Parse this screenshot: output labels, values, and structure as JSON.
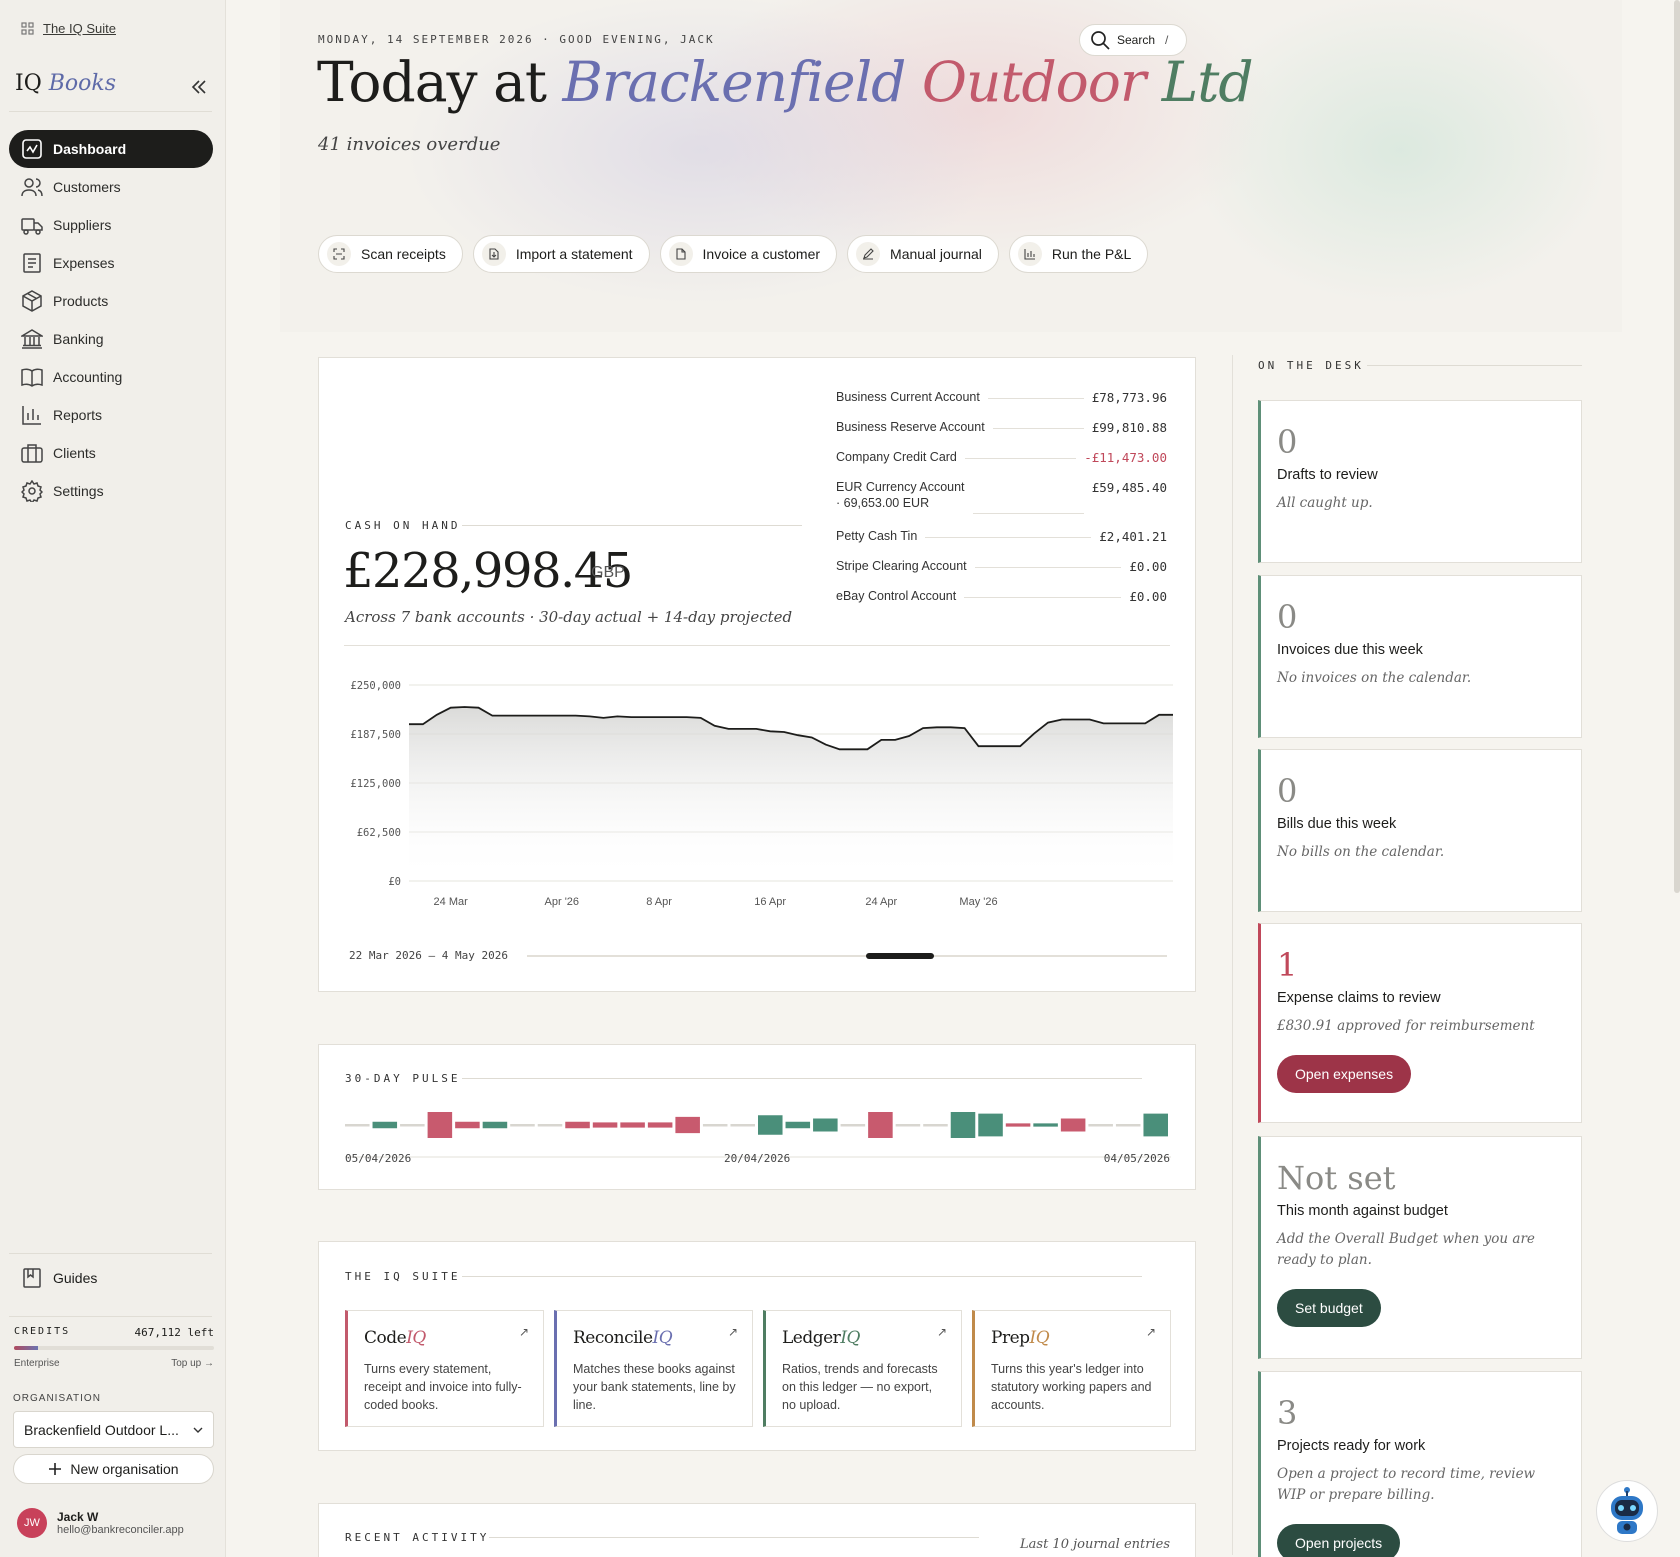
{
  "sidebar": {
    "suite_link": "The IQ Suite",
    "brand_a": "IQ",
    "brand_b": "Books",
    "nav": [
      {
        "label": "Dashboard",
        "icon": "dashboard-icon",
        "active": true
      },
      {
        "label": "Customers",
        "icon": "users-icon"
      },
      {
        "label": "Suppliers",
        "icon": "truck-icon"
      },
      {
        "label": "Expenses",
        "icon": "receipt-icon"
      },
      {
        "label": "Products",
        "icon": "box-icon"
      },
      {
        "label": "Banking",
        "icon": "bank-icon"
      },
      {
        "label": "Accounting",
        "icon": "book-icon"
      },
      {
        "label": "Reports",
        "icon": "bar-chart-icon"
      },
      {
        "label": "Clients",
        "icon": "briefcase-icon"
      },
      {
        "label": "Settings",
        "icon": "gear-icon"
      }
    ],
    "guides": "Guides",
    "credits_label": "CREDITS",
    "credits_value": "467,112 left",
    "credits_fraction": 0.12,
    "plan": "Enterprise",
    "top_up": "Top up →",
    "org_label": "ORGANISATION",
    "org_value": "Brackenfield Outdoor L...",
    "new_org": "New organisation",
    "user_initials": "JW",
    "user_name": "Jack W",
    "user_email": "hello@bankreconciler.app"
  },
  "hero": {
    "date_line": "MONDAY, 14 SEPTEMBER 2026 · GOOD EVENING, JACK",
    "search_label": "Search",
    "search_key": "/",
    "title_prefix": "Today at",
    "title_w1": "Brackenfield",
    "title_w2": "Outdoor",
    "title_w3": "Ltd",
    "subtitle": "41 invoices overdue",
    "actions": [
      {
        "label": "Scan receipts",
        "icon": "scan-icon"
      },
      {
        "label": "Import a statement",
        "icon": "file-import-icon"
      },
      {
        "label": "Invoice a customer",
        "icon": "invoice-icon"
      },
      {
        "label": "Manual journal",
        "icon": "pen-icon"
      },
      {
        "label": "Run the P&L",
        "icon": "chart-icon"
      }
    ]
  },
  "cash": {
    "caption": "CASH ON HAND",
    "amount": "£228,998.45",
    "currency": "GBP",
    "subtitle": "Across 7 bank accounts · 30-day actual + 14-day projected",
    "accounts": [
      {
        "name": "Business Current Account",
        "value": "£78,773.96"
      },
      {
        "name": "Business Reserve Account",
        "value": "£99,810.88"
      },
      {
        "name": "Company Credit Card",
        "value": "-£11,473.00",
        "negative": true
      },
      {
        "name": "EUR Currency Account",
        "sub": "· 69,653.00 EUR",
        "value": "£59,485.40"
      },
      {
        "name": "Petty Cash Tin",
        "value": "£2,401.21"
      },
      {
        "name": "Stripe Clearing Account",
        "value": "£0.00"
      },
      {
        "name": "eBay Control Account",
        "value": "£0.00"
      }
    ],
    "range_label": "22 Mar 2026 – 4 May 2026"
  },
  "chart_data": [
    {
      "type": "area",
      "title": "",
      "y_ticks": [
        "£250,000",
        "£187,500",
        "£125,000",
        "£62,500",
        "£0"
      ],
      "ylim": [
        0,
        250000
      ],
      "x_ticks": [
        "24 Mar",
        "Apr '26",
        "8 Apr",
        "16 Apr",
        "24 Apr",
        "May '26"
      ],
      "x_tick_index": [
        3,
        11,
        18,
        26,
        34,
        41
      ],
      "grid": true,
      "series": [
        {
          "values": [
            200000,
            200000,
            212000,
            221000,
            222000,
            221000,
            211000,
            211000,
            211000,
            211000,
            211000,
            211000,
            211000,
            210000,
            208000,
            210000,
            209000,
            209000,
            209000,
            209000,
            209000,
            208000,
            198000,
            194000,
            194000,
            194000,
            191000,
            190000,
            186000,
            183000,
            174000,
            168000,
            168000,
            168000,
            180000,
            180000,
            185000,
            195000,
            196000,
            196000,
            195000,
            172000,
            172000,
            172000,
            172000,
            188000,
            202000,
            206000,
            206000,
            206000,
            201000,
            201000,
            201000,
            201000,
            212000,
            212000
          ]
        }
      ]
    },
    {
      "type": "bar",
      "title": "30-DAY PULSE",
      "x_ticks": [
        "05/04/2026",
        "20/04/2026",
        "04/05/2026"
      ],
      "series": [
        {
          "values": [
            0,
            1,
            0,
            -4,
            -1,
            1,
            0,
            0,
            -1,
            -0.8,
            -0.8,
            -0.8,
            -2.5,
            0,
            0,
            3,
            1,
            2,
            0,
            -4,
            0,
            0,
            4,
            3.5,
            -0.5,
            0.5,
            -2,
            0,
            0,
            3.5
          ]
        }
      ]
    }
  ],
  "pulse": {
    "caption": "30-DAY PULSE",
    "d1": "05/04/2026",
    "d2": "20/04/2026",
    "d3": "04/05/2026"
  },
  "suite": {
    "caption": "THE IQ SUITE",
    "tiles": [
      {
        "a": "Code",
        "b": "IQ",
        "desc": "Turns every statement, receipt and invoice into fully-coded books.",
        "color": "#c25a6c"
      },
      {
        "a": "Reconcile",
        "b": "IQ",
        "desc": "Matches these books against your bank statements, line by line.",
        "color": "#6a6fb0"
      },
      {
        "a": "Ledger",
        "b": "IQ",
        "desc": "Ratios, trends and forecasts on this ledger — no export, no upload.",
        "color": "#4f7d62"
      },
      {
        "a": "Prep",
        "b": "IQ",
        "desc": "Turns this year's ledger into statutory working papers and accounts.",
        "color": "#c08a4a"
      }
    ]
  },
  "recent": {
    "caption": "RECENT ACTIVITY",
    "note": "Last 10 journal entries"
  },
  "desk": {
    "caption": "ON THE DESK",
    "cards": [
      {
        "num": "0",
        "title": "Drafts to review",
        "sub": "All caught up."
      },
      {
        "num": "0",
        "title": "Invoices due this week",
        "sub": "No invoices on the calendar."
      },
      {
        "num": "0",
        "title": "Bills due this week",
        "sub": "No bills on the calendar."
      },
      {
        "num": "1",
        "title": "Expense claims to review",
        "sub": "£830.91 approved for reimbursement",
        "button": "Open expenses"
      },
      {
        "num": "Not set",
        "title": "This month against budget",
        "sub": "Add the Overall Budget when you are ready to plan.",
        "button": "Set budget"
      },
      {
        "num": "3",
        "title": "Projects ready for work",
        "sub": "Open a project to record time, review WIP or prepare billing.",
        "button": "Open projects"
      }
    ]
  },
  "colors": {
    "accent_red": "#9d3448",
    "accent_green": "#2c4c41",
    "pulse_pos": "#4a8f7a",
    "pulse_neg": "#c85a6e"
  }
}
